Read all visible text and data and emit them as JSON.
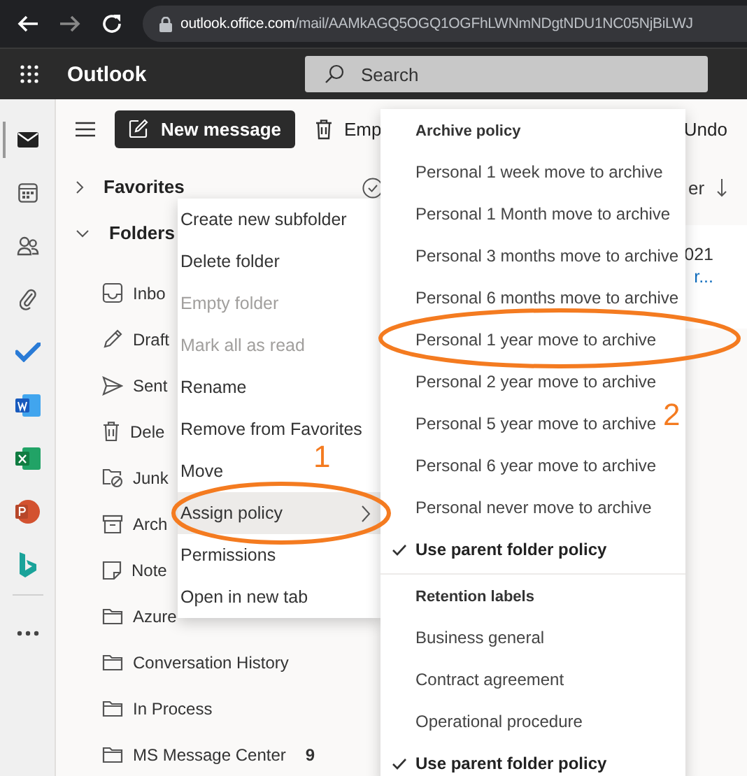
{
  "browser": {
    "url_host": "outlook.office.com",
    "url_path": "/mail/AAMkAGQ5OGQ1OGFhLWNmNDgtNDU1NC05NjBiLWJ"
  },
  "app_bar": {
    "title": "Outlook",
    "search": {
      "placeholder": "Search"
    }
  },
  "rail": [
    {
      "kind": "mail",
      "selected": true
    },
    {
      "kind": "calendar",
      "selected": false
    },
    {
      "kind": "people",
      "selected": false
    },
    {
      "kind": "files",
      "selected": false
    },
    {
      "kind": "todo",
      "selected": false
    },
    {
      "kind": "word",
      "selected": false
    },
    {
      "kind": "excel",
      "selected": false
    },
    {
      "kind": "powerpoint",
      "selected": false
    },
    {
      "kind": "bing",
      "selected": false
    },
    {
      "kind": "more",
      "selected": false
    }
  ],
  "toolbar": {
    "new_message": "New message",
    "empty": "Emp",
    "undo": "Undo"
  },
  "folder_pane": {
    "sections": [
      {
        "label": "Favorites",
        "expanded": false
      },
      {
        "label": "Folders",
        "expanded": true,
        "children": [
          {
            "label": "Inbo",
            "kind": "inbox"
          },
          {
            "label": "Draft",
            "kind": "drafts"
          },
          {
            "label": "Sent",
            "kind": "sent"
          },
          {
            "label": "Dele",
            "kind": "deleted"
          },
          {
            "label": "Junk",
            "kind": "junk"
          },
          {
            "label": "Arch",
            "kind": "archive"
          },
          {
            "label": "Note",
            "kind": "notes"
          },
          {
            "label": "Azure",
            "kind": "folder"
          },
          {
            "label": "Conversation History",
            "kind": "folder"
          },
          {
            "label": "In Process",
            "kind": "folder"
          },
          {
            "label": "MS Message Center",
            "kind": "folder",
            "count": "9"
          }
        ]
      }
    ]
  },
  "message_list": {
    "header_fragment": "er",
    "date_fragment": "021",
    "preview_fragment": "r..."
  },
  "context_menu": {
    "items": [
      {
        "label": "Create new subfolder",
        "disabled": false,
        "selected": false,
        "submenu": false
      },
      {
        "label": "Delete folder",
        "disabled": false,
        "selected": false,
        "submenu": false
      },
      {
        "label": "Empty folder",
        "disabled": true,
        "selected": false,
        "submenu": false
      },
      {
        "label": "Mark all as read",
        "disabled": true,
        "selected": false,
        "submenu": false
      },
      {
        "label": "Rename",
        "disabled": false,
        "selected": false,
        "submenu": false
      },
      {
        "label": "Remove from Favorites",
        "disabled": false,
        "selected": false,
        "submenu": false
      },
      {
        "label": "Move",
        "disabled": false,
        "selected": false,
        "submenu": false
      },
      {
        "label": "Assign policy",
        "disabled": false,
        "selected": true,
        "submenu": true
      },
      {
        "label": "Permissions",
        "disabled": false,
        "selected": false,
        "submenu": false
      },
      {
        "label": "Open in new tab",
        "disabled": false,
        "selected": false,
        "submenu": false
      }
    ]
  },
  "submenu": {
    "sections": [
      {
        "heading": "Archive policy",
        "items": [
          {
            "label": "Personal 1 week move to archive",
            "checked": false
          },
          {
            "label": "Personal 1 Month move to archive",
            "checked": false
          },
          {
            "label": "Personal 3 months move to archive",
            "checked": false
          },
          {
            "label": "Personal 6 months move to archive",
            "checked": false
          },
          {
            "label": "Personal 1 year move to archive",
            "checked": false
          },
          {
            "label": "Personal 2 year move to archive",
            "checked": false
          },
          {
            "label": "Personal 5 year move to archive",
            "checked": false
          },
          {
            "label": "Personal 6 year move to archive",
            "checked": false
          },
          {
            "label": "Personal never move to archive",
            "checked": false
          },
          {
            "label": "Use parent folder policy",
            "checked": true
          }
        ]
      },
      {
        "heading": "Retention labels",
        "items": [
          {
            "label": "Business general",
            "checked": false
          },
          {
            "label": "Contract agreement",
            "checked": false
          },
          {
            "label": "Operational procedure",
            "checked": false
          },
          {
            "label": "Use parent folder policy",
            "checked": true
          }
        ]
      }
    ]
  },
  "annotations": [
    {
      "label": "1"
    },
    {
      "label": "2"
    }
  ]
}
